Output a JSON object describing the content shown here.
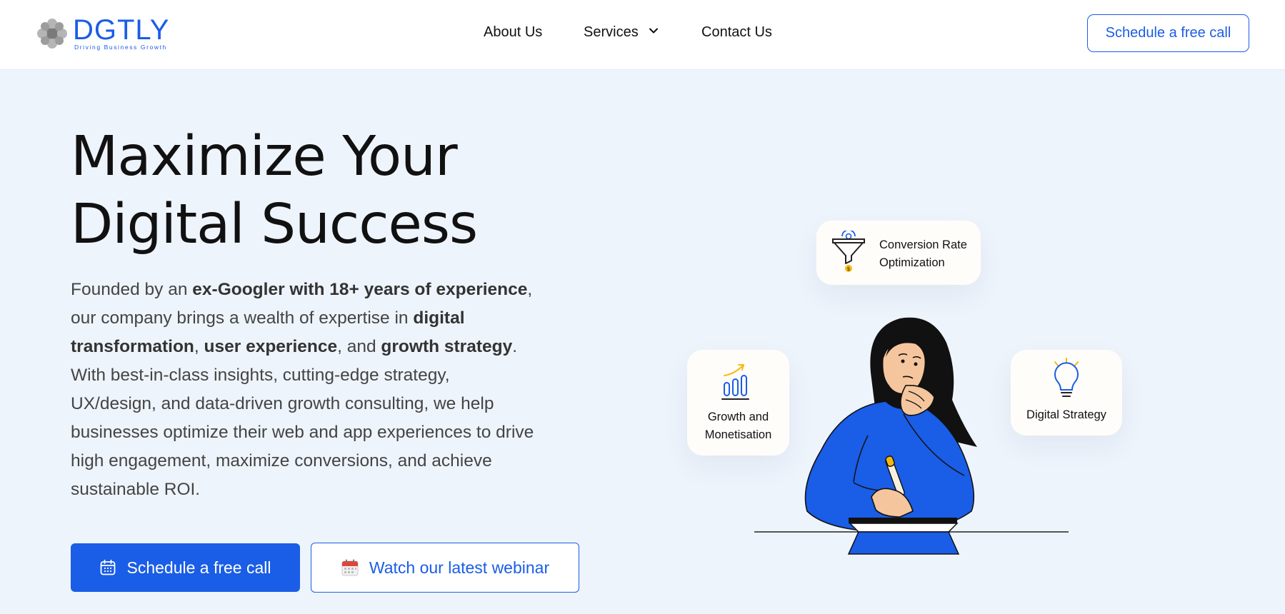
{
  "brand": {
    "name": "DGTLY",
    "tagline": "Driving Business Growth"
  },
  "nav": {
    "about": "About Us",
    "services": "Services",
    "contact": "Contact Us",
    "cta": "Schedule a free call"
  },
  "hero": {
    "title_line1": "Maximize Your",
    "title_line2": "Digital Success",
    "desc": [
      {
        "t": "Founded by an ",
        "b": false
      },
      {
        "t": "ex-Googler with 18+ years of experience",
        "b": true
      },
      {
        "t": ", our company brings a wealth of expertise in ",
        "b": false
      },
      {
        "t": "digital transformation",
        "b": true
      },
      {
        "t": ", ",
        "b": false
      },
      {
        "t": "user experience",
        "b": true
      },
      {
        "t": ", and ",
        "b": false
      },
      {
        "t": "growth strategy",
        "b": true
      },
      {
        "t": ". With best-in-class insights, cutting-edge strategy, UX/design, and data-driven growth consulting, we help businesses optimize their web and app experiences to drive high engagement, maximize conversions, and achieve sustainable ROI.",
        "b": false
      }
    ],
    "primary_button": "Schedule a free call",
    "secondary_button": "Watch our latest webinar"
  },
  "cards": {
    "cro_line1": "Conversion Rate",
    "cro_line2": "Optimization",
    "growth_line1": "Growth and",
    "growth_line2": "Monetisation",
    "strategy": "Digital Strategy"
  },
  "icons": {
    "logo": "logo-icon",
    "services_chevron": "chevron-down-icon",
    "calendar": "calendar-icon",
    "webinar_calendar": "calendar-emoji-icon",
    "funnel": "funnel-icon",
    "bar_chart": "bar-chart-icon",
    "lightbulb": "lightbulb-icon"
  },
  "colors": {
    "accent": "#1a5de6",
    "background": "#eef4fc",
    "header": "#ffffff"
  }
}
